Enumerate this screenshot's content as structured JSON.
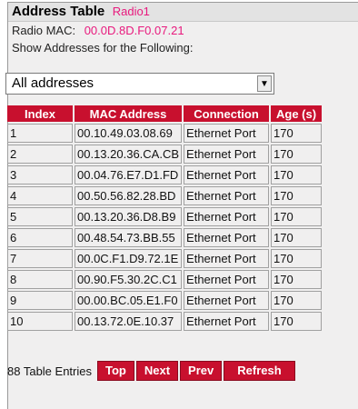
{
  "header": {
    "title": "Address Table",
    "radio": "Radio1"
  },
  "radio_mac": {
    "label": "Radio MAC:",
    "value": "00.0D.8D.F0.07.21"
  },
  "show_label": "Show Addresses for the Following:",
  "filter_select": {
    "value": "All addresses"
  },
  "table": {
    "columns": [
      "Index",
      "MAC Address",
      "Connection",
      "Age (s)"
    ],
    "rows": [
      [
        "1",
        "00.10.49.03.08.69",
        "Ethernet Port",
        "170"
      ],
      [
        "2",
        "00.13.20.36.CA.CB",
        "Ethernet Port",
        "170"
      ],
      [
        "3",
        "00.04.76.E7.D1.FD",
        "Ethernet Port",
        "170"
      ],
      [
        "4",
        "00.50.56.82.28.BD",
        "Ethernet Port",
        "170"
      ],
      [
        "5",
        "00.13.20.36.D8.B9",
        "Ethernet Port",
        "170"
      ],
      [
        "6",
        "00.48.54.73.BB.55",
        "Ethernet Port",
        "170"
      ],
      [
        "7",
        "00.0C.F1.D9.72.1E",
        "Ethernet Port",
        "170"
      ],
      [
        "8",
        "00.90.F5.30.2C.C1",
        "Ethernet Port",
        "170"
      ],
      [
        "9",
        "00.00.BC.05.E1.F0",
        "Ethernet Port",
        "170"
      ],
      [
        "10",
        "00.13.72.0E.10.37",
        "Ethernet Port",
        "170"
      ]
    ]
  },
  "footer": {
    "entries": "88 Table Entries",
    "buttons": {
      "top": "Top",
      "next": "Next",
      "prev": "Prev",
      "refresh": "Refresh"
    }
  },
  "colors": {
    "accent": "#c8102e",
    "highlight": "#e8197d",
    "panel": "#f0efef"
  },
  "icons": {
    "dropdown": "chevron-down-icon"
  }
}
